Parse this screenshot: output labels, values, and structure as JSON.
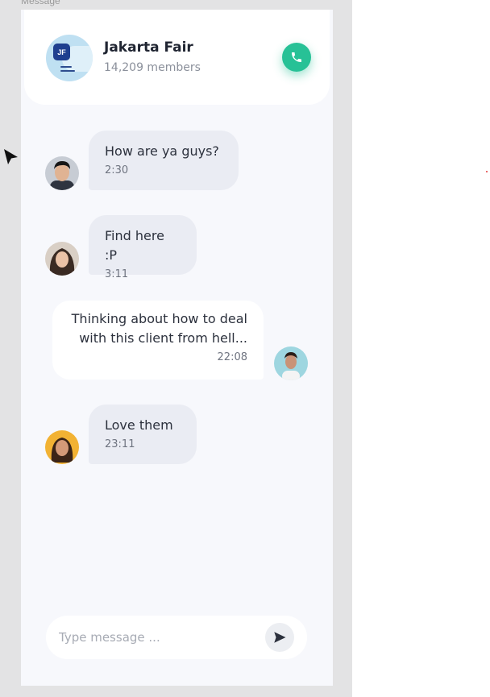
{
  "frame": {
    "label": "Message"
  },
  "header": {
    "group_name": "Jakarta Fair",
    "members": "14,209 members",
    "avatar_badge": "JF",
    "call_icon": "phone-icon"
  },
  "messages": [
    {
      "text": "How are ya guys?",
      "time": "2:30",
      "direction": "incoming"
    },
    {
      "text": "Find here :P",
      "time": "3:11",
      "direction": "incoming"
    },
    {
      "text_line1": "Thinking about how to deal",
      "text_line2": "with this client from hell...",
      "time": "22:08",
      "direction": "outgoing"
    },
    {
      "text": "Love them",
      "time": "23:11",
      "direction": "incoming"
    }
  ],
  "composer": {
    "placeholder": "Type message ...",
    "value": "",
    "send_icon": "send-icon"
  },
  "colors": {
    "accent": "#27c196",
    "incoming_bubble": "#eaecf3",
    "outgoing_bubble": "#ffffff",
    "app_background": "#f7f8fc"
  }
}
